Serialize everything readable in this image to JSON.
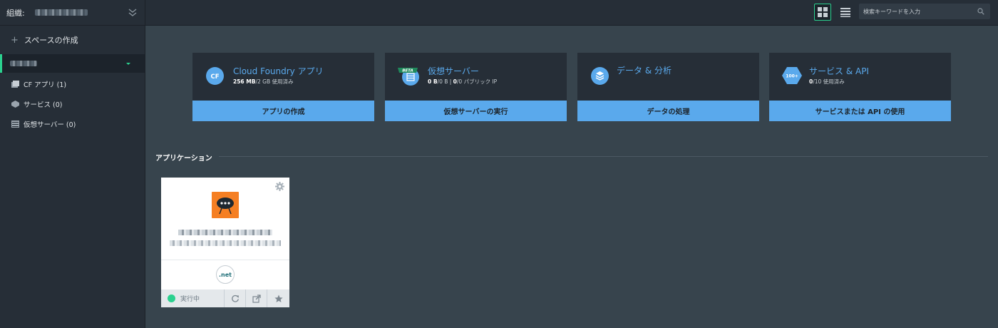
{
  "org": {
    "label": "組織:"
  },
  "sidebar": {
    "create_space": "スペースの作成",
    "items": [
      {
        "label": "CF アプリ (1)",
        "icon": "cf-apps-icon"
      },
      {
        "label": "サービス (0)",
        "icon": "services-icon"
      },
      {
        "label": "仮想サーバー (0)",
        "icon": "virtual-servers-icon"
      }
    ]
  },
  "topbar": {
    "search_placeholder": "検索キーワードを入力"
  },
  "tiles": [
    {
      "icon_text": "CF",
      "title": "Cloud Foundry アプリ",
      "sub_bold": "256 MB",
      "sub_rest": "/2 GB 使用済み",
      "button": "アプリの作成"
    },
    {
      "badge": "BETA",
      "title": "仮想サーバー",
      "sub_bold": "0 B",
      "sub_rest": "/0 B | ",
      "sub_bold2": "0",
      "sub_rest2": "/0 パブリック IP",
      "button": "仮想サーバーの実行"
    },
    {
      "title": "データ & 分析",
      "button": "データの処理"
    },
    {
      "icon_text": "100+",
      "title": "サービス & API",
      "sub_bold": "0",
      "sub_rest": "/10 使用済み",
      "button": "サービスまたは API の使用"
    }
  ],
  "section": {
    "title": "アプリケーション"
  },
  "app": {
    "runtime": ".net",
    "status": "実行中"
  },
  "colors": {
    "accent": "#5aa9ec",
    "running": "#2bd18f",
    "app_logo": "#f57f23"
  }
}
